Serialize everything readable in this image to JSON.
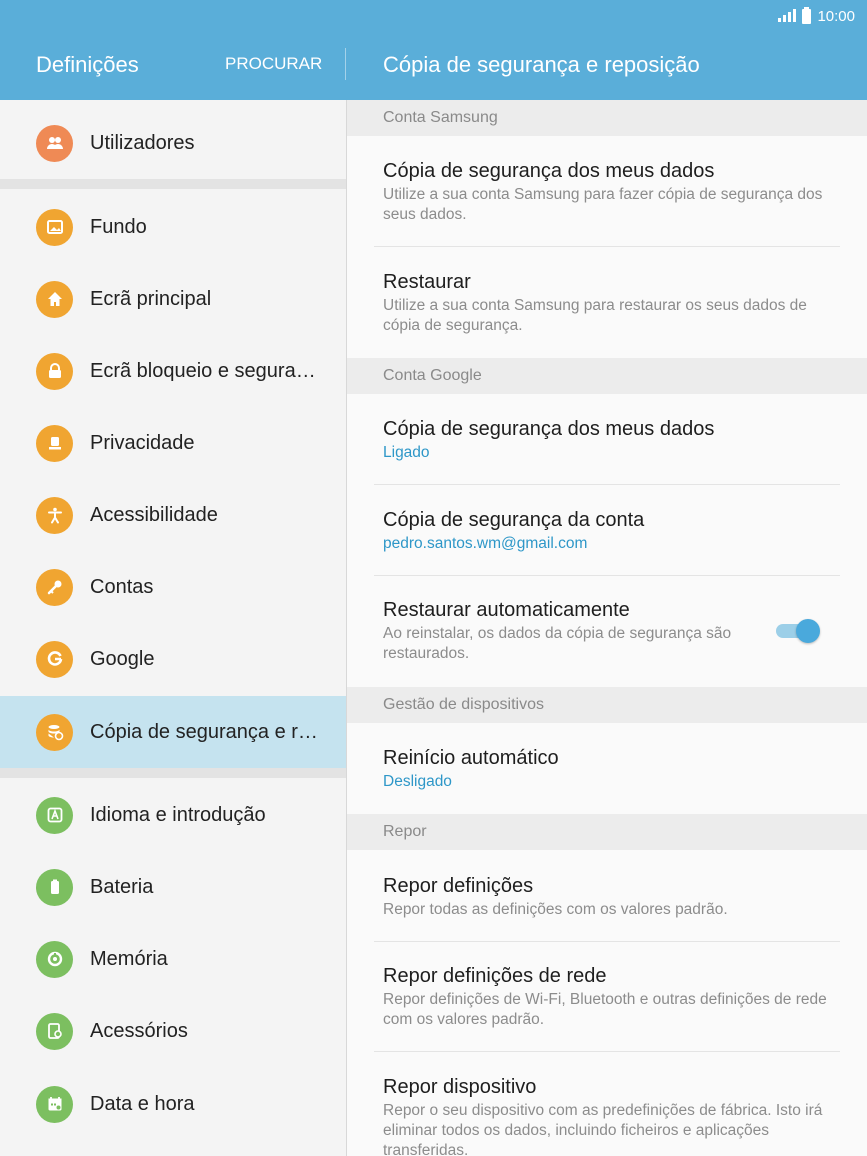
{
  "status_bar": {
    "time": "10:00",
    "signal_icon": "signal-icon",
    "battery_icon": "battery-icon"
  },
  "app_bar": {
    "left_title": "Definições",
    "search_label": "PROCURAR",
    "right_title": "Cópia de segurança e reposição",
    "color": "#5aaed9"
  },
  "sidebar": {
    "items": [
      {
        "label": "Utilizadores",
        "icon": "users-icon",
        "color": "#ef8a55"
      },
      {
        "label": "Fundo",
        "icon": "wallpaper-icon",
        "color": "#f0a531"
      },
      {
        "label": "Ecrã principal",
        "icon": "home-icon",
        "color": "#f0a531"
      },
      {
        "label": "Ecrã bloqueio e segura…",
        "icon": "lock-icon",
        "color": "#f0a531"
      },
      {
        "label": "Privacidade",
        "icon": "privacy-icon",
        "color": "#f0a531"
      },
      {
        "label": "Acessibilidade",
        "icon": "accessibility-icon",
        "color": "#f0a531"
      },
      {
        "label": "Contas",
        "icon": "key-icon",
        "color": "#f0a531"
      },
      {
        "label": "Google",
        "icon": "google-icon",
        "color": "#f0a531"
      },
      {
        "label": "Cópia de segurança e r…",
        "icon": "backup-icon",
        "color": "#f0a531",
        "selected": true
      },
      {
        "label": "Idioma e introdução",
        "icon": "language-icon",
        "color": "#7cbf60"
      },
      {
        "label": "Bateria",
        "icon": "battery-icon",
        "color": "#7cbf60"
      },
      {
        "label": "Memória",
        "icon": "memory-icon",
        "color": "#7cbf60"
      },
      {
        "label": "Acessórios",
        "icon": "accessories-icon",
        "color": "#7cbf60"
      },
      {
        "label": "Data e hora",
        "icon": "calendar-icon",
        "color": "#7cbf60"
      }
    ]
  },
  "content": {
    "sections": [
      {
        "header": "Conta Samsung",
        "items": [
          {
            "title": "Cópia de segurança dos meus dados",
            "subtitle": "Utilize a sua conta Samsung para fazer cópia de segurança dos seus dados."
          },
          {
            "title": "Restaurar",
            "subtitle": "Utilize a sua conta Samsung para restaurar os seus dados de cópia de segurança."
          }
        ]
      },
      {
        "header": "Conta Google",
        "items": [
          {
            "title": "Cópia de segurança dos meus dados",
            "subtitle": "Ligado"
          },
          {
            "title": "Cópia de segurança da conta",
            "subtitle": "pedro.santos.wm@gmail.com"
          },
          {
            "title": "Restaurar automaticamente",
            "subtitle": "Ao reinstalar, os dados da cópia de segurança são restaurados.",
            "toggle_on": true
          }
        ]
      },
      {
        "header": "Gestão de dispositivos",
        "items": [
          {
            "title": "Reinício automático",
            "subtitle": "Desligado"
          }
        ]
      },
      {
        "header": "Repor",
        "items": [
          {
            "title": "Repor definições",
            "subtitle": "Repor todas as definições com os valores padrão."
          },
          {
            "title": "Repor definições de rede",
            "subtitle": "Repor definições de Wi-Fi, Bluetooth e outras definições de rede com os valores padrão."
          },
          {
            "title": "Repor dispositivo",
            "subtitle": "Repor o seu dispositivo com as predefinições de fábrica. Isto irá eliminar todos os dados, incluindo ficheiros e aplicações transferidas."
          }
        ]
      }
    ]
  }
}
